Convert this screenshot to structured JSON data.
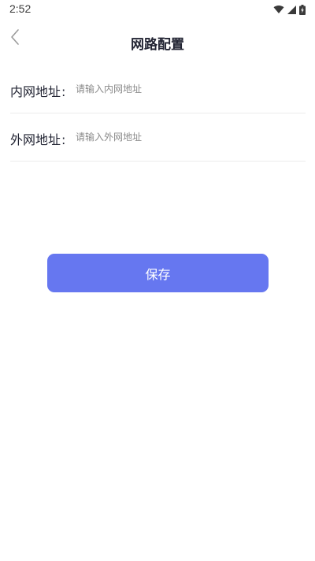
{
  "status_bar": {
    "time": "2:52",
    "icons": [
      "wifi-icon",
      "signal-icon",
      "battery-charging-icon"
    ]
  },
  "header": {
    "back_icon": "chevron-left-icon",
    "title": "网路配置"
  },
  "form": {
    "fields": [
      {
        "label": "内网地址",
        "colon": ":",
        "value": "",
        "placeholder": "请输入内网地址"
      },
      {
        "label": "外网地址",
        "colon": ":",
        "value": "",
        "placeholder": "请输入外网地址"
      }
    ]
  },
  "actions": {
    "save_label": "保存"
  },
  "colors": {
    "primary": "#6677f0",
    "title_text": "#222433",
    "placeholder_text": "#8a8a8a",
    "divider": "#ececec"
  }
}
